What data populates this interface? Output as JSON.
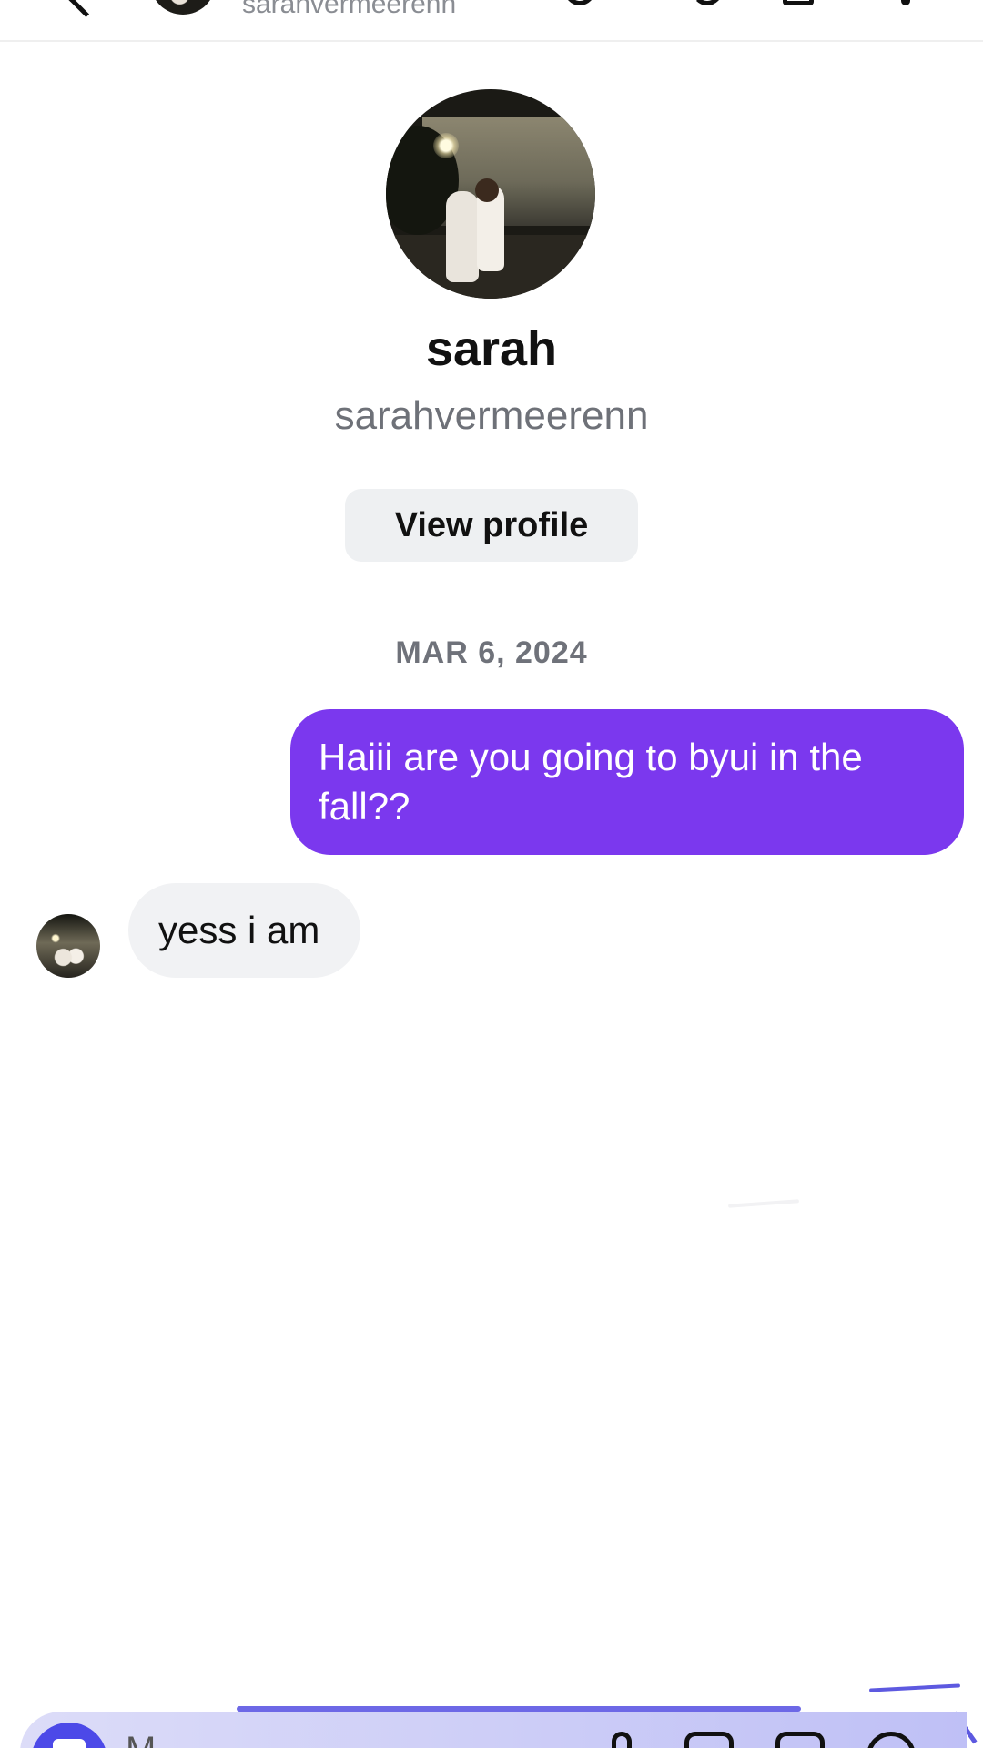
{
  "header": {
    "username": "sarahvermeerenn",
    "icons": [
      "back-icon",
      "avatar",
      "phone-icon",
      "video-icon",
      "flag-icon",
      "more-icon"
    ]
  },
  "profile": {
    "name": "sarah",
    "username": "sarahvermeerenn",
    "view_profile_label": "View profile"
  },
  "conversation": {
    "date": "MAR 6, 2024",
    "messages": [
      {
        "direction": "outgoing",
        "text": "Haiii are you going to byui in the fall??"
      },
      {
        "direction": "incoming",
        "text": "yess i am"
      }
    ]
  },
  "composer": {
    "placeholder": "M...",
    "icons": [
      "camera-icon",
      "microphone-icon",
      "gallery-icon",
      "sticker-icon",
      "plus-icon"
    ]
  },
  "colors": {
    "outgoing_bubble": "#7b38ee",
    "incoming_bubble": "#f1f2f4",
    "secondary_text": "#6e7178",
    "camera_button": "#4c49e8"
  }
}
